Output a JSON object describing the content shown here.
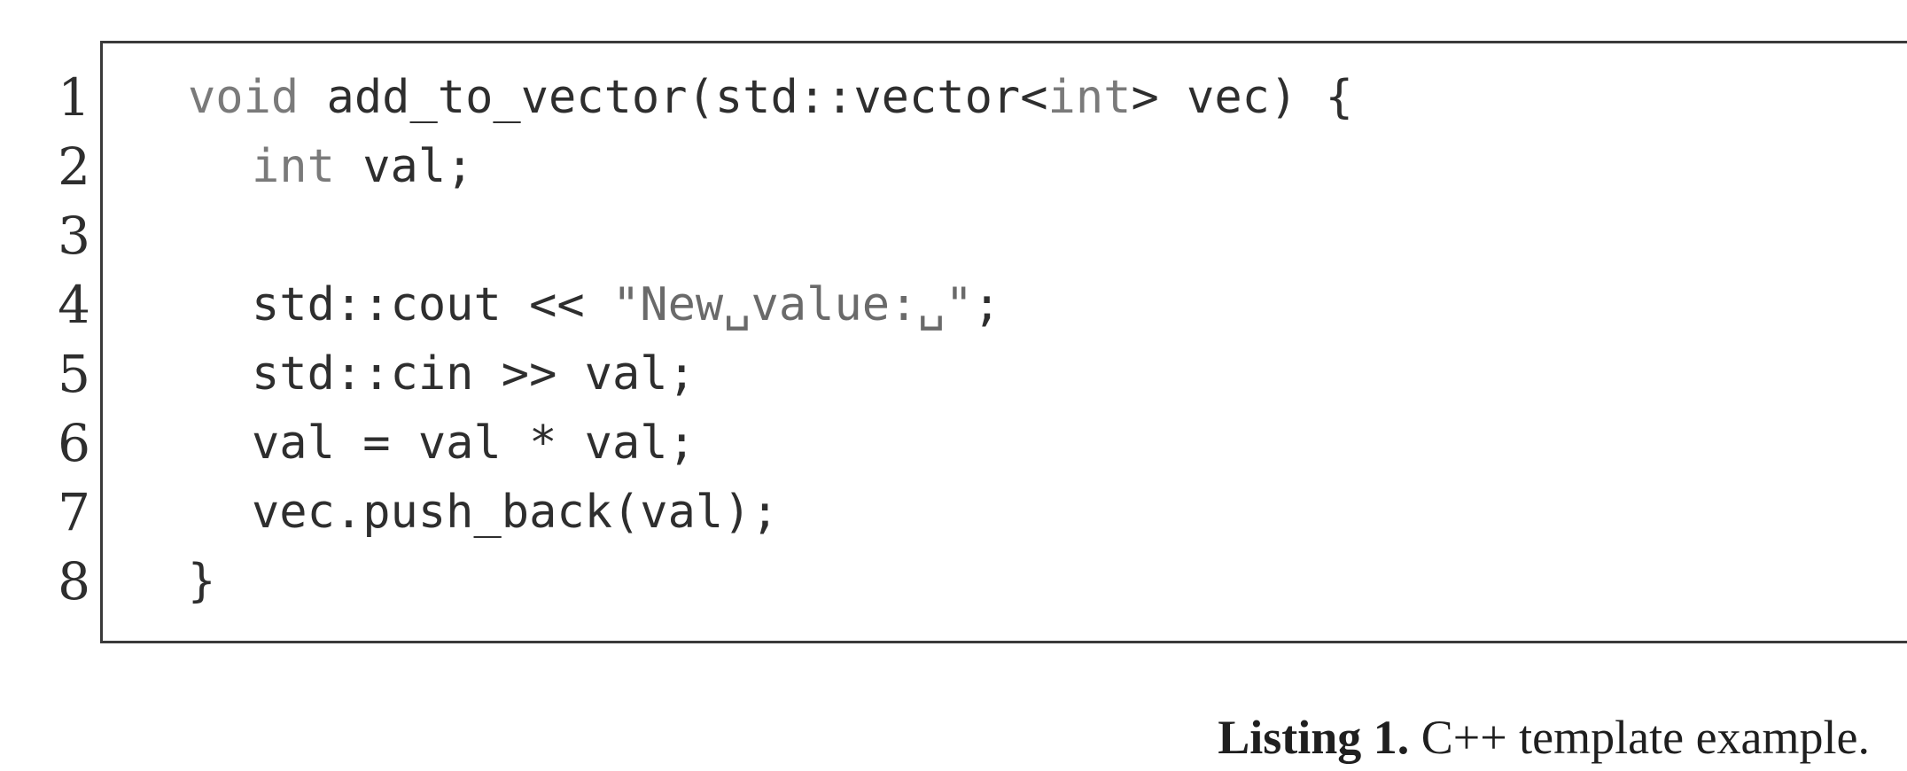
{
  "line_numbers": [
    "1",
    "2",
    "3",
    "4",
    "5",
    "6",
    "7",
    "8"
  ],
  "code": {
    "line1": {
      "kw_void": "void",
      "fn_open": " add_to_vector(std::vector<",
      "kw_int": "int",
      "fn_close": "> vec) {"
    },
    "line2": {
      "kw_int": "int",
      "rest": " val;"
    },
    "line3": "",
    "line4": {
      "pre": "std::cout << ",
      "str": "\"New␣value:␣\"",
      "post": ";"
    },
    "line5": "std::cin >> val;",
    "line6": "val = val * val;",
    "line7": "vec.push_back(val);",
    "line8": "}"
  },
  "caption": {
    "label": "Listing 1.",
    "text": " C++ template example."
  }
}
